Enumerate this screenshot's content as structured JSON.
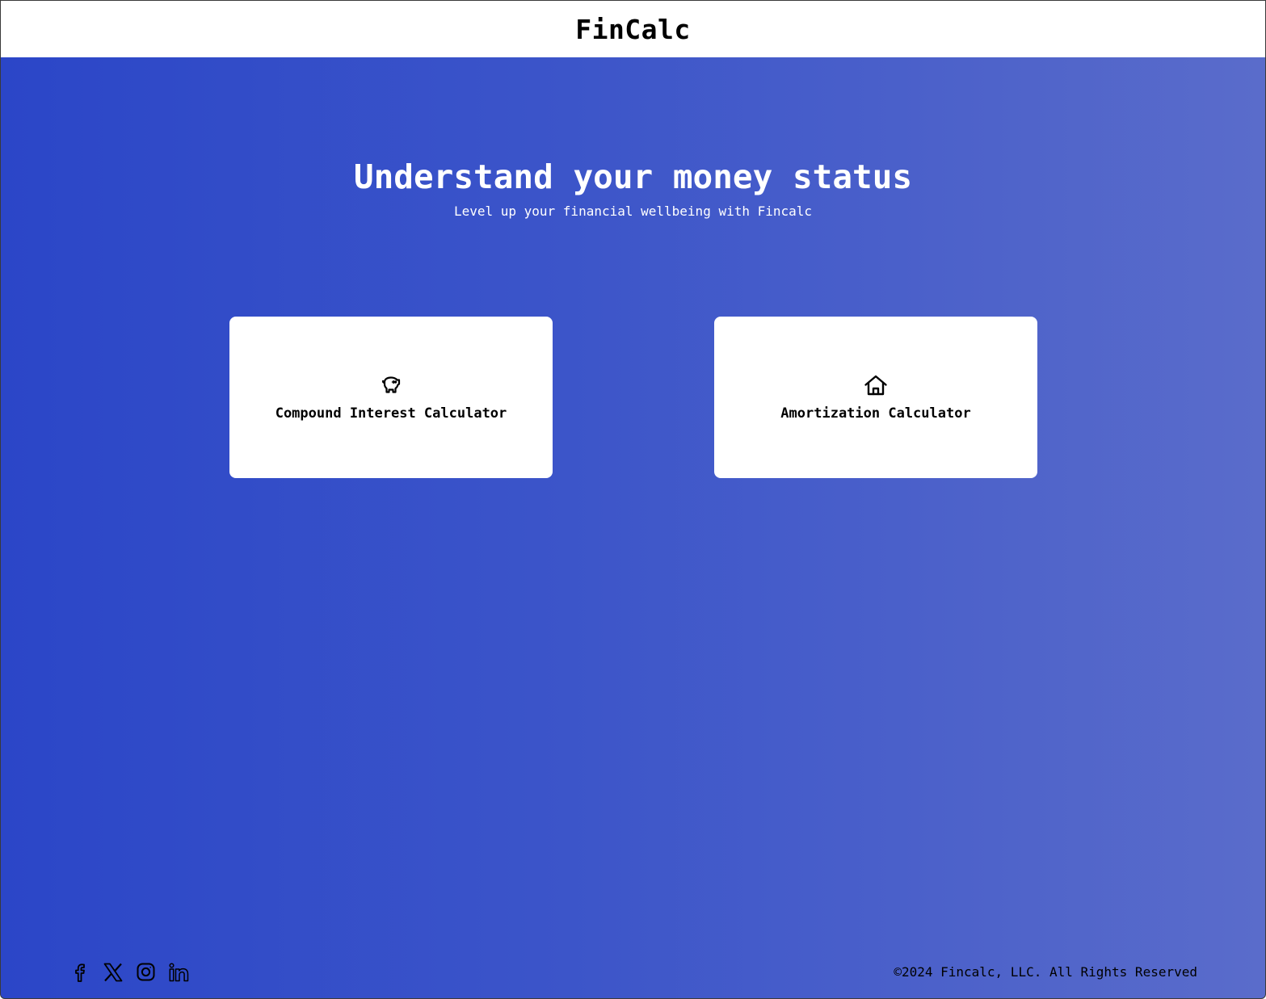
{
  "header": {
    "brand": "FinCalc"
  },
  "hero": {
    "title": "Understand your money status",
    "subtitle": "Level up your financial wellbeing with Fincalc"
  },
  "cards": [
    {
      "label": "Compound Interest Calculator",
      "icon": "piggy-bank-icon"
    },
    {
      "label": "Amortization Calculator",
      "icon": "house-icon"
    }
  ],
  "footer": {
    "socials": [
      "facebook-icon",
      "x-icon",
      "instagram-icon",
      "linkedin-icon"
    ],
    "copyright": "©2024 Fincalc, LLC. All Rights Reserved"
  },
  "colors": {
    "gradient_start": "#2b46c8",
    "gradient_end": "#5a6ccb",
    "card_bg": "#ffffff",
    "header_bg": "#ffffff"
  }
}
